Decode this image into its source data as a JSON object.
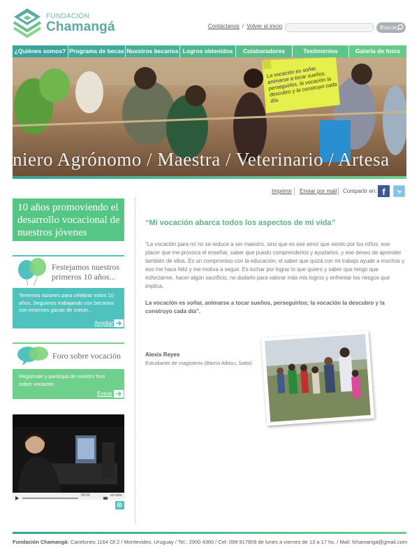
{
  "header": {
    "logo_small": "FUNDACIÓN",
    "logo_big": "Chamangá",
    "contact_link": "Contáctanos",
    "separator": "/",
    "home_link": "Volver al inicio",
    "search_placeholder": "",
    "search_button": "Buscar"
  },
  "nav": {
    "items": [
      {
        "label": "¿Quiénes somos?",
        "color": "#3aa39a"
      },
      {
        "label": "Programa de becas",
        "color": "#3fab98"
      },
      {
        "label": "Nuestros becarios",
        "color": "#45b295"
      },
      {
        "label": "Logros obtenidos",
        "color": "#4cb890"
      },
      {
        "label": "Colaboradores",
        "color": "#55c08c"
      },
      {
        "label": "Testimonios",
        "color": "#5cc689"
      },
      {
        "label": "Galería de fotos",
        "color": "#63cb86"
      }
    ]
  },
  "banner": {
    "caption": "niero Agrónomo / Maestra / Veterinario / Artesa",
    "note": "La vocación es soñar, animarse a tocar sueños, perseguirlos, la vocación la descubro y la construyo cada día."
  },
  "share": {
    "print": "Imprimir",
    "email": "Enviar por mail",
    "share_label": "Compartir en:"
  },
  "sidebar": {
    "promo": "10 años promoviendo el desarrollo vocacional de nuestros jóvenes",
    "anniversary": {
      "title": "Festejamos nuestros primeros 10 años...",
      "text": "Tenemos razones para celebrar estos 10 años. Seguimos trabajando con becarios con enormes ganas de crecer...",
      "link": "Ampliar"
    },
    "forum": {
      "title": "Foro sobre vocación",
      "text": "Regístrate y participá de nuestro foro sobre vocación",
      "link": "Entrar"
    },
    "video": {
      "time": "00:00",
      "hd": "en tubo"
    }
  },
  "article": {
    "quote_title": "“Mi vocación abarca todos los aspectos de mi vida”",
    "body": "“La vocación para mí no se reduce a ser maestro, sino que es ese amor que siento por los niños, ese placer que me provoca el enseñar, saber que puedo comprenderlos y ayudarlos, y ese deseo de aprender también de ellos. Es un compromiso con la educación; el saber que quizá con mi trabajo ayude a muchos y eso me hace feliz y me motiva a seguir. Es luchar por lograr lo que quiero y saber que tengo que esforzarme, hacer algún sacrificio, no dudarlo para valorar más mis logros y enfrentar los riesgos que implica.",
    "bold": "La vocación es soñar, animarse a tocar sueños, perseguirlos; la vocación la descubro y la construyo cada día”.",
    "author": "Alexis Reyes",
    "author_role": "Estudiante de magisterio (Barrio Albisu, Salto)"
  },
  "footer": {
    "org": "Fundación Chamangá:",
    "details": "Canelones 1164 Of.2 / Montevideo, Uruguay / Tel.: 2900 4360 / Cel: 098 917809 de lunes a viernes de 13 a 17 hs. / Mail: fchamanga@gmail.com"
  }
}
